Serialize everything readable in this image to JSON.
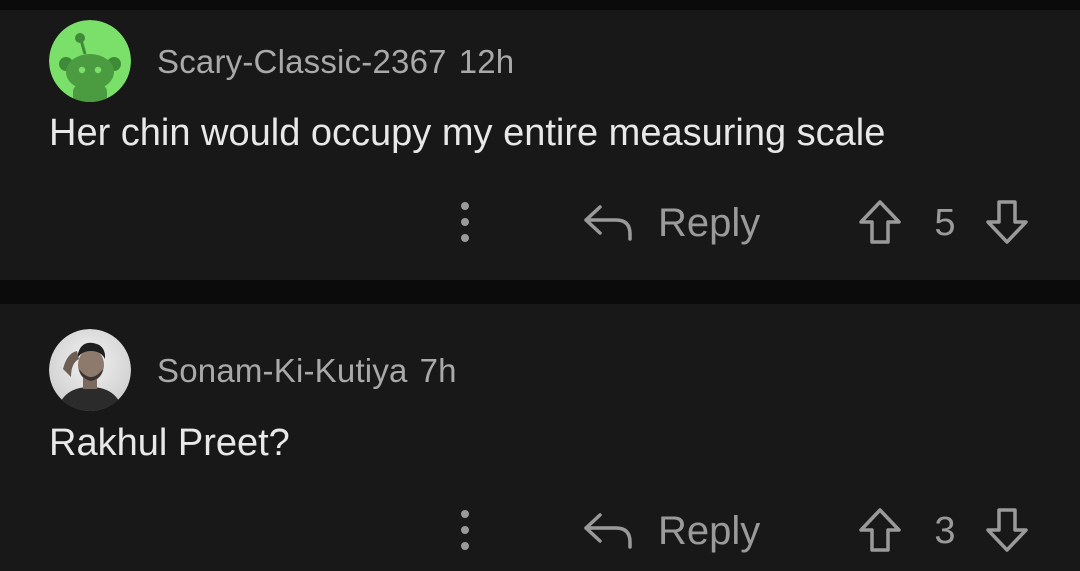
{
  "colors": {
    "background": "#0b0b0b",
    "comment_bg": "#181818",
    "username_text": "#a9a9a9",
    "body_text": "#e8e8e8",
    "action_text": "#9a9a9a",
    "avatar_green": "#7be06a"
  },
  "comments": [
    {
      "username": "Scary-Classic-2367",
      "time": "12h",
      "body": "Her chin would occupy my entire measuring scale",
      "avatar_icon": "reddit-snoo-avatar-icon",
      "reply_label": "Reply",
      "score": "5"
    },
    {
      "username": "Sonam-Ki-Kutiya",
      "time": "7h",
      "body": "Rakhul Preet?",
      "avatar_icon": "user-photo-avatar",
      "reply_label": "Reply",
      "score": "3"
    }
  ],
  "icons": {
    "more": "vertical-dots-icon",
    "reply": "reply-arrow-icon",
    "upvote": "upvote-arrow-icon",
    "downvote": "downvote-arrow-icon"
  }
}
